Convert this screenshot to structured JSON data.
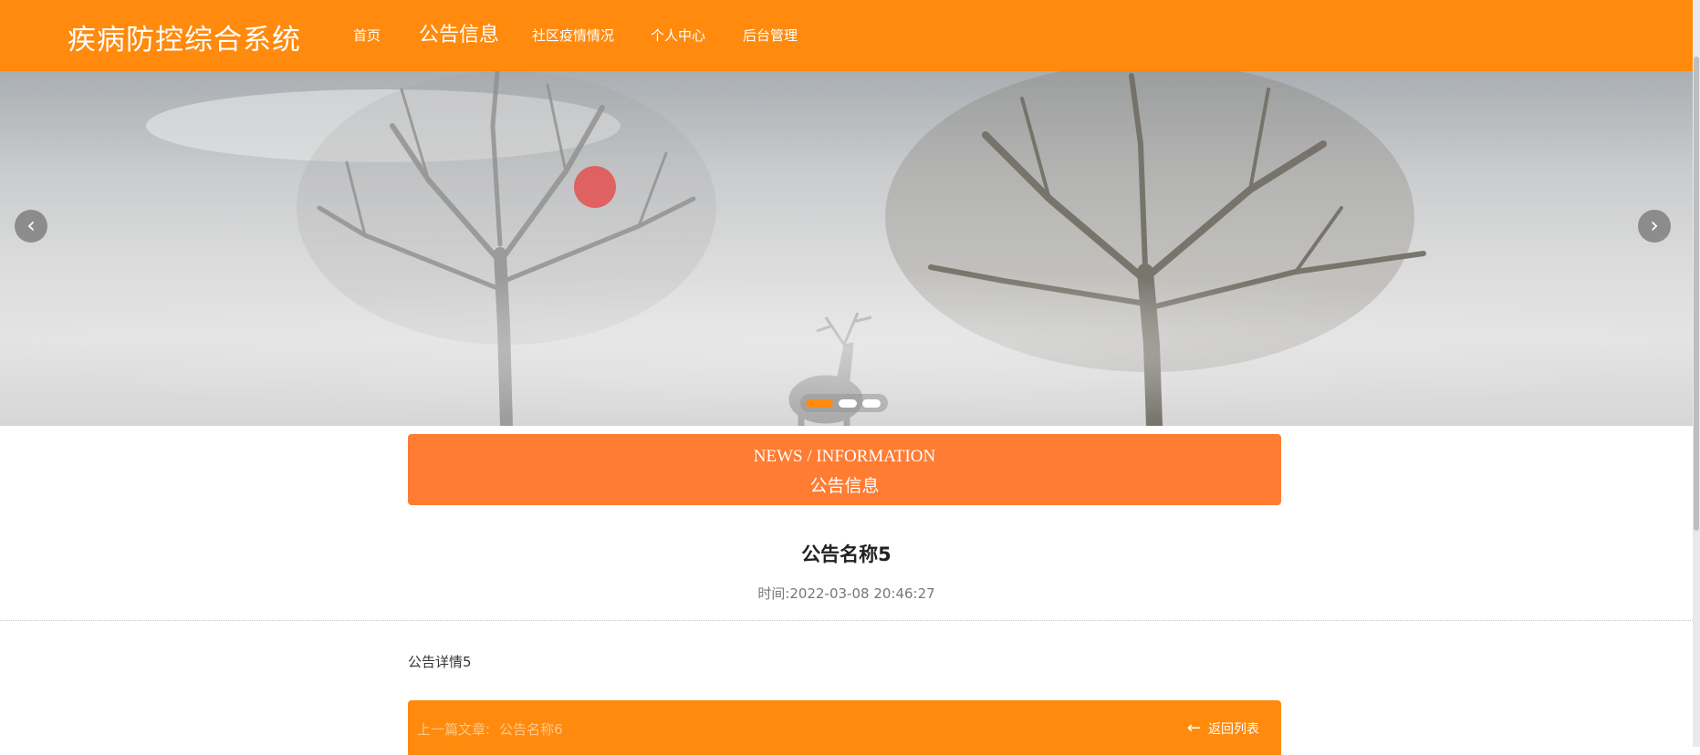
{
  "site": {
    "title": "疾病防控综合系统"
  },
  "nav": {
    "items": [
      {
        "label": "首页",
        "active": false
      },
      {
        "label": "公告信息",
        "active": true
      },
      {
        "label": "社区疫情情况",
        "active": false
      },
      {
        "label": "个人中心",
        "active": false
      },
      {
        "label": "后台管理",
        "active": false
      }
    ]
  },
  "carousel": {
    "prev_icon": "chevron-left-icon",
    "next_icon": "chevron-right-icon",
    "prev_glyph": "‹",
    "next_glyph": "›",
    "slide_count": 3,
    "active_slide": 1
  },
  "section": {
    "title_en": "NEWS / INFORMATION",
    "title_zh": "公告信息"
  },
  "article": {
    "title": "公告名称5",
    "time_label": "时间:",
    "time_value": "2022-03-08 20:46:27",
    "body": "公告详情5"
  },
  "footer_nav": {
    "prev_label": "上一篇文章:",
    "prev_link": "公告名称6",
    "back_arrow": "←",
    "back_label": "返回列表"
  },
  "colors": {
    "brand_orange": "#ff8a0d",
    "header_orange": "#ff7c33",
    "cursor_highlight": "#e84040"
  }
}
